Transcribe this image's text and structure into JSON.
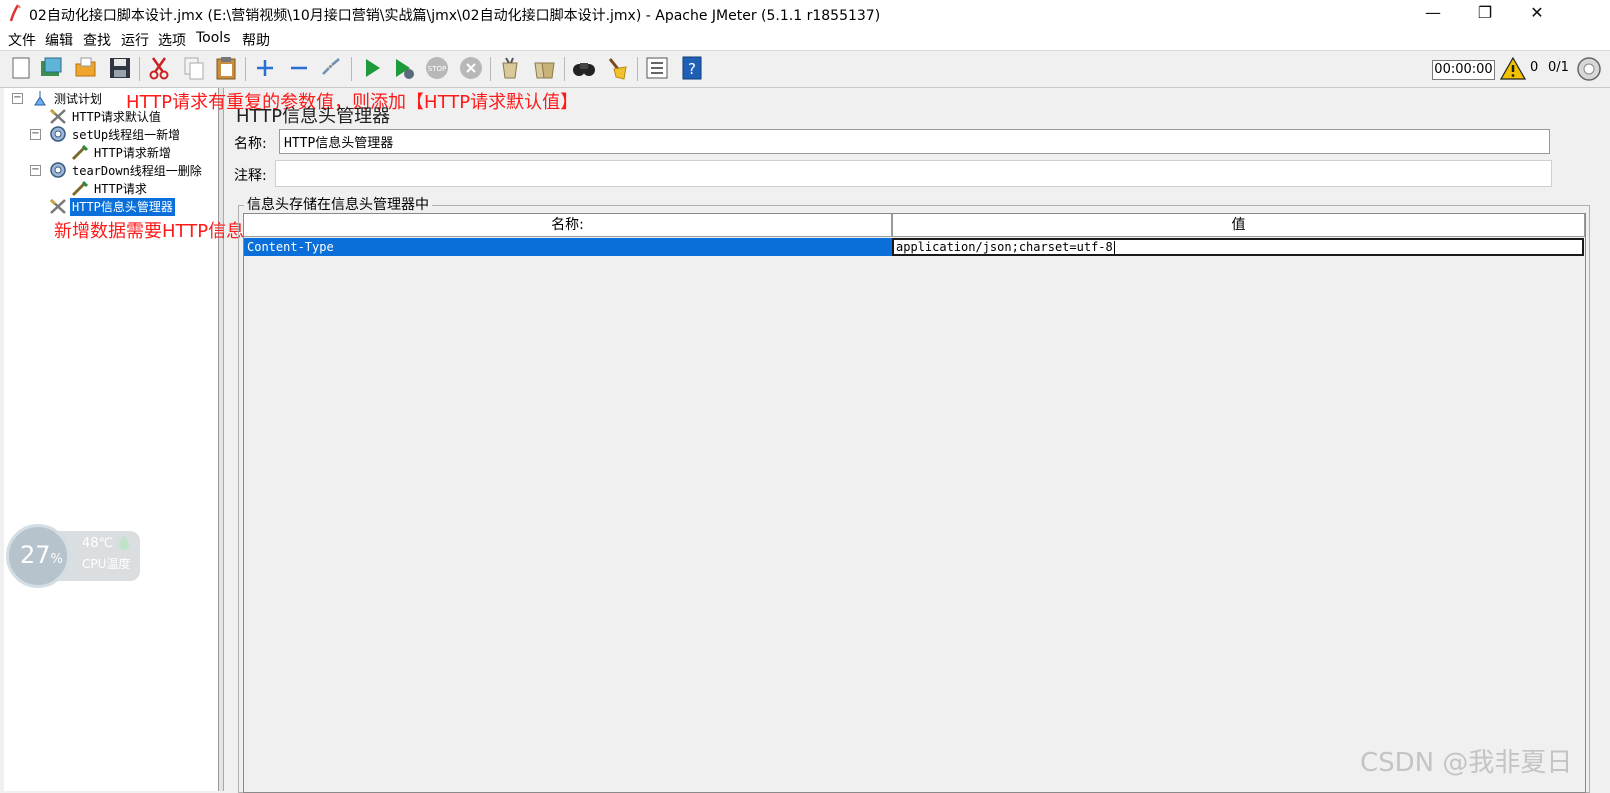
{
  "window": {
    "title": "02自动化接口脚本设计.jmx (E:\\营销视频\\10月接口营销\\实战篇\\jmx\\02自动化接口脚本设计.jmx) - Apache JMeter (5.1.1 r1855137)",
    "minimize": "—",
    "maximize": "❐",
    "close": "✕"
  },
  "menu": [
    "文件",
    "编辑",
    "查找",
    "运行",
    "选项",
    "Tools",
    "帮助"
  ],
  "toolbar": {
    "timer": "00:00:00",
    "warning_count": "0",
    "thread_ratio": "0/1",
    "icons": [
      "new-file-icon",
      "templates-icon",
      "open-icon",
      "save-icon",
      "cut-icon",
      "copy-icon",
      "paste-icon",
      "expand-icon",
      "collapse-icon",
      "toggle-icon",
      "start-icon",
      "start-no-pause-icon",
      "stop-icon",
      "shutdown-icon",
      "clear-icon",
      "clear-all-icon",
      "search-icon",
      "reset-search-icon",
      "function-helper-icon",
      "help-icon"
    ]
  },
  "tree": {
    "items": [
      {
        "label": "测试计划"
      },
      {
        "label": "HTTP请求默认值"
      },
      {
        "label": "setUp线程组一新增"
      },
      {
        "label": "HTTP请求新增"
      },
      {
        "label": "tearDown线程组一删除"
      },
      {
        "label": "HTTP请求"
      },
      {
        "label": "HTTP信息头管理器"
      }
    ]
  },
  "annotations": {
    "top": "HTTP请求有重复的参数值，则添加【HTTP请求默认值】",
    "middle": "新增数据需要HTTP信息头管理器"
  },
  "content": {
    "title": "HTTP信息头管理器",
    "name_label": "名称:",
    "name_value": "HTTP信息头管理器",
    "comment_label": "注释:",
    "comment_value": "",
    "group_title": "信息头存储在信息头管理器中",
    "table": {
      "columns": [
        "名称:",
        "值"
      ],
      "rows": [
        {
          "name": "Content-Type",
          "value": "application/json;charset=utf-8"
        }
      ]
    }
  },
  "cpu_widget": {
    "percent": "27",
    "unit": "%",
    "temperature": "48℃",
    "label": "CPU温度"
  },
  "watermark": "CSDN @我非夏日",
  "colors": {
    "selection": "#0a6fd8",
    "annotation": "#ff1a1a",
    "background": "#f0f0f0"
  }
}
